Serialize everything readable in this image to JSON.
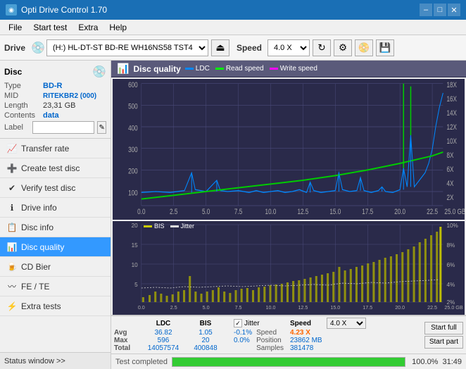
{
  "window": {
    "title": "Opti Drive Control 1.70",
    "min_btn": "–",
    "max_btn": "□",
    "close_btn": "✕"
  },
  "menu": {
    "items": [
      "File",
      "Start test",
      "Extra",
      "Help"
    ]
  },
  "drive_bar": {
    "label": "Drive",
    "drive_value": "(H:) HL-DT-ST BD-RE  WH16NS58 TST4",
    "speed_label": "Speed",
    "speed_value": "4.0 X"
  },
  "disc": {
    "title": "Disc",
    "type_label": "Type",
    "type_value": "BD-R",
    "mid_label": "MID",
    "mid_value": "RITEKBR2 (000)",
    "length_label": "Length",
    "length_value": "23,31 GB",
    "contents_label": "Contents",
    "contents_value": "data",
    "label_label": "Label",
    "label_value": ""
  },
  "sidebar": {
    "items": [
      {
        "id": "transfer-rate",
        "label": "Transfer rate",
        "active": false
      },
      {
        "id": "create-test-disc",
        "label": "Create test disc",
        "active": false
      },
      {
        "id": "verify-test-disc",
        "label": "Verify test disc",
        "active": false
      },
      {
        "id": "drive-info",
        "label": "Drive info",
        "active": false
      },
      {
        "id": "disc-info",
        "label": "Disc info",
        "active": false
      },
      {
        "id": "disc-quality",
        "label": "Disc quality",
        "active": true
      },
      {
        "id": "cd-bier",
        "label": "CD Bier",
        "active": false
      },
      {
        "id": "fe-te",
        "label": "FE / TE",
        "active": false
      },
      {
        "id": "extra-tests",
        "label": "Extra tests",
        "active": false
      }
    ],
    "status_window": "Status window >>"
  },
  "disc_quality": {
    "title": "Disc quality",
    "legend": [
      {
        "label": "LDC",
        "color": "#00aaff"
      },
      {
        "label": "Read speed",
        "color": "#00ff00"
      },
      {
        "label": "Write speed",
        "color": "#ff00ff"
      }
    ],
    "legend2": [
      {
        "label": "BIS",
        "color": "#cccc00"
      },
      {
        "label": "Jitter",
        "color": "#ffffff"
      }
    ]
  },
  "stats": {
    "headers": [
      "",
      "LDC",
      "BIS",
      "",
      "Jitter",
      "Speed",
      ""
    ],
    "avg_label": "Avg",
    "avg_ldc": "36.82",
    "avg_bis": "1.05",
    "avg_jitter": "-0.1%",
    "max_label": "Max",
    "max_ldc": "596",
    "max_bis": "20",
    "max_jitter": "0.0%",
    "total_label": "Total",
    "total_ldc": "14057574",
    "total_bis": "400848",
    "jitter_label": "Jitter",
    "speed_label": "Speed",
    "speed_value": "4.23 X",
    "speed_select": "4.0 X",
    "position_label": "Position",
    "position_value": "23862 MB",
    "samples_label": "Samples",
    "samples_value": "381478",
    "start_full_label": "Start full",
    "start_part_label": "Start part"
  },
  "progress": {
    "label": "Test completed",
    "percent": 100,
    "percent_text": "100.0%",
    "time": "31:49"
  },
  "chart1": {
    "y_max": 600,
    "y_labels": [
      "600",
      "500",
      "400",
      "300",
      "200",
      "100"
    ],
    "y_right_labels": [
      "18X",
      "16X",
      "14X",
      "12X",
      "10X",
      "8X",
      "6X",
      "4X",
      "2X"
    ],
    "x_labels": [
      "0.0",
      "2.5",
      "5.0",
      "7.5",
      "10.0",
      "12.5",
      "15.0",
      "17.5",
      "20.0",
      "22.5",
      "25.0 GB"
    ]
  },
  "chart2": {
    "y_max": 20,
    "y_labels": [
      "20",
      "15",
      "10",
      "5"
    ],
    "y_right_labels": [
      "10%",
      "8%",
      "6%",
      "4%",
      "2%"
    ],
    "x_labels": [
      "0.0",
      "2.5",
      "5.0",
      "7.5",
      "10.0",
      "12.5",
      "15.0",
      "17.5",
      "20.0",
      "22.5",
      "25.0 GB"
    ]
  }
}
